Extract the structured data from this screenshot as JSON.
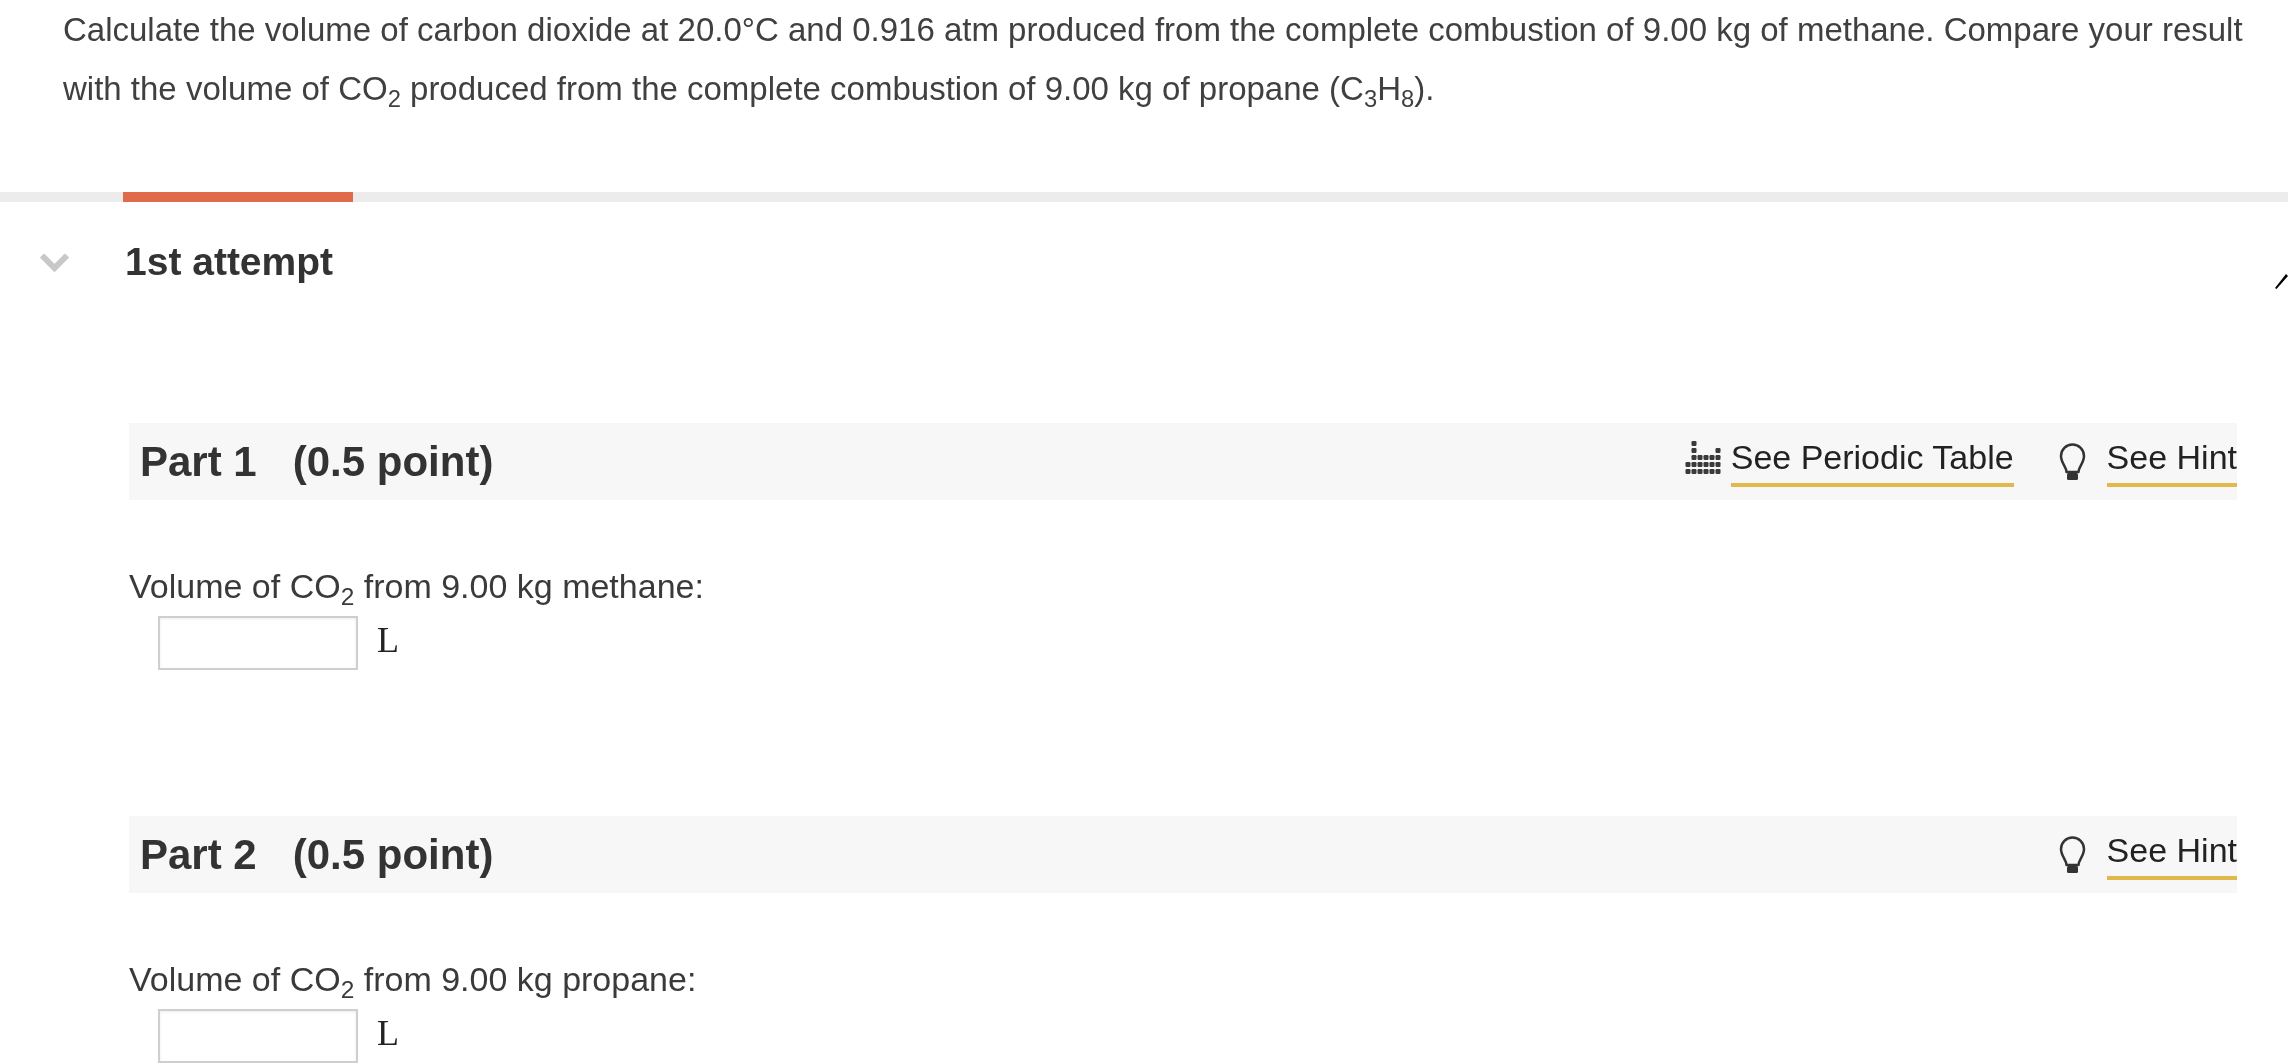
{
  "question": {
    "text": "Calculate the volume of carbon dioxide at 20.0°C and 0.916 atm produced from the complete combustion of 9.00 kg of methane. Compare your result with the volume of CO$_{2}$ produced from the complete combustion of 9.00 kg of propane (C$_{3}$H$_{8}$)."
  },
  "attempt": {
    "title": "1st attempt",
    "expanded": true,
    "selected": true
  },
  "parts": [
    {
      "title": "Part 1",
      "points": "(0.5 point)",
      "tools": [
        {
          "kind": "periodic_table",
          "label": "See Periodic Table"
        },
        {
          "kind": "hint",
          "label": "See Hint"
        }
      ],
      "prompt": "Volume of CO$_{2}$ from 9.00 kg methane:",
      "unit": "L"
    },
    {
      "title": "Part 2",
      "points": "(0.5 point)",
      "tools": [
        {
          "kind": "hint",
          "label": "See Hint"
        }
      ],
      "prompt": "Volume of CO$_{2}$ from 9.00 kg propane:",
      "unit": "L"
    }
  ]
}
